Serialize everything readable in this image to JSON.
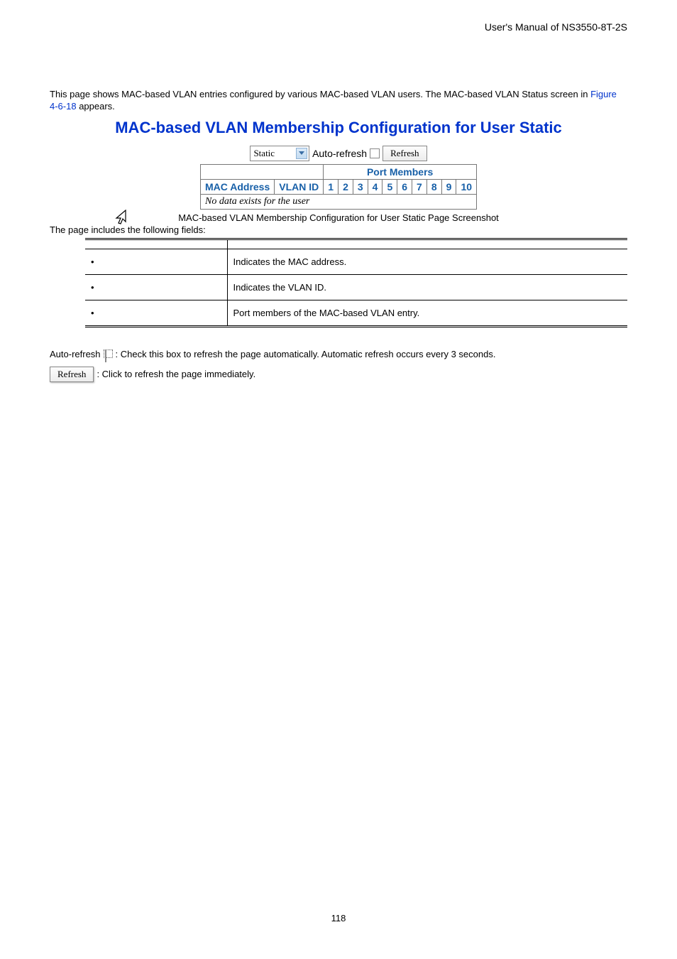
{
  "header": {
    "doc_title": "User's Manual of NS3550-8T-2S"
  },
  "intro": {
    "line1": "This page shows MAC-based VLAN entries configured by various MAC-based VLAN users. The MAC-based VLAN Status screen in ",
    "figure_link": "Figure 4-6-18",
    "line2": " appears."
  },
  "section_title": "MAC-based VLAN Membership Configuration for User Static",
  "screenshot": {
    "select_value": "Static",
    "auto_refresh_label": "Auto-refresh",
    "refresh_label": "Refresh",
    "port_members_header": "Port Members",
    "columns": {
      "mac": "MAC Address",
      "vlan": "VLAN ID"
    },
    "ports": [
      "1",
      "2",
      "3",
      "4",
      "5",
      "6",
      "7",
      "8",
      "9",
      "10"
    ],
    "no_data": "No data exists for the user"
  },
  "caption": "MAC-based VLAN Membership Configuration for User Static Page Screenshot",
  "fields_intro": "The page includes the following fields:",
  "fields": [
    {
      "desc": "Indicates the MAC address."
    },
    {
      "desc": "Indicates the VLAN ID."
    },
    {
      "desc": "Port members of the MAC-based VLAN entry."
    }
  ],
  "footer": {
    "auto_refresh_prefix": "Auto-refresh ",
    "auto_refresh_text": ": Check this box to refresh the page automatically. Automatic refresh occurs every 3 seconds.",
    "refresh_btn": "Refresh",
    "refresh_text": ": Click to refresh the page immediately."
  },
  "page_number": "118"
}
